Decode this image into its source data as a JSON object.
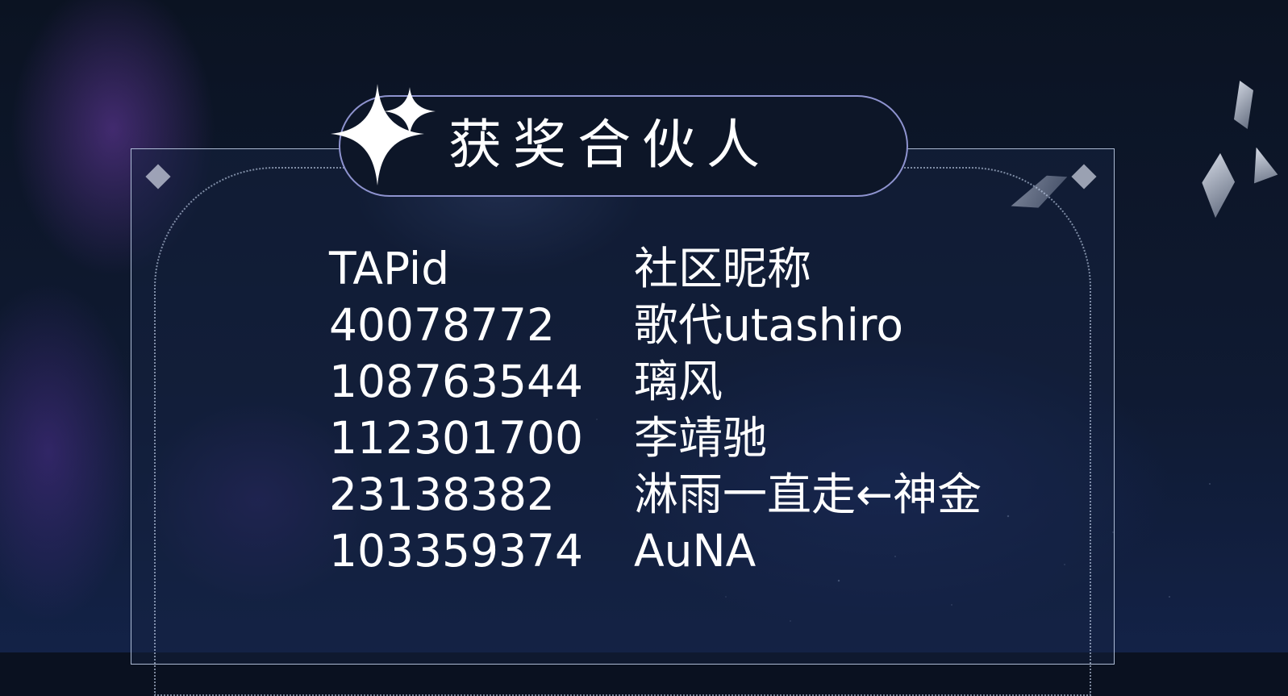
{
  "title": "获奖合伙人",
  "table": {
    "headers": [
      "TAPid",
      "社区昵称"
    ],
    "rows": [
      [
        "40078772",
        "歌代utashiro"
      ],
      [
        "108763544",
        "璃风"
      ],
      [
        "112301700",
        "李靖驰"
      ],
      [
        "23138382",
        "淋雨一直走←神金"
      ],
      [
        "103359374",
        "AuNA"
      ]
    ]
  },
  "icons": {
    "title_decoration": "sparkle-icon",
    "corner_decoration": "diamond-icon"
  },
  "colors": {
    "background": "#0a1120",
    "pill_border": "#8e93cf",
    "text": "#ffffff"
  }
}
